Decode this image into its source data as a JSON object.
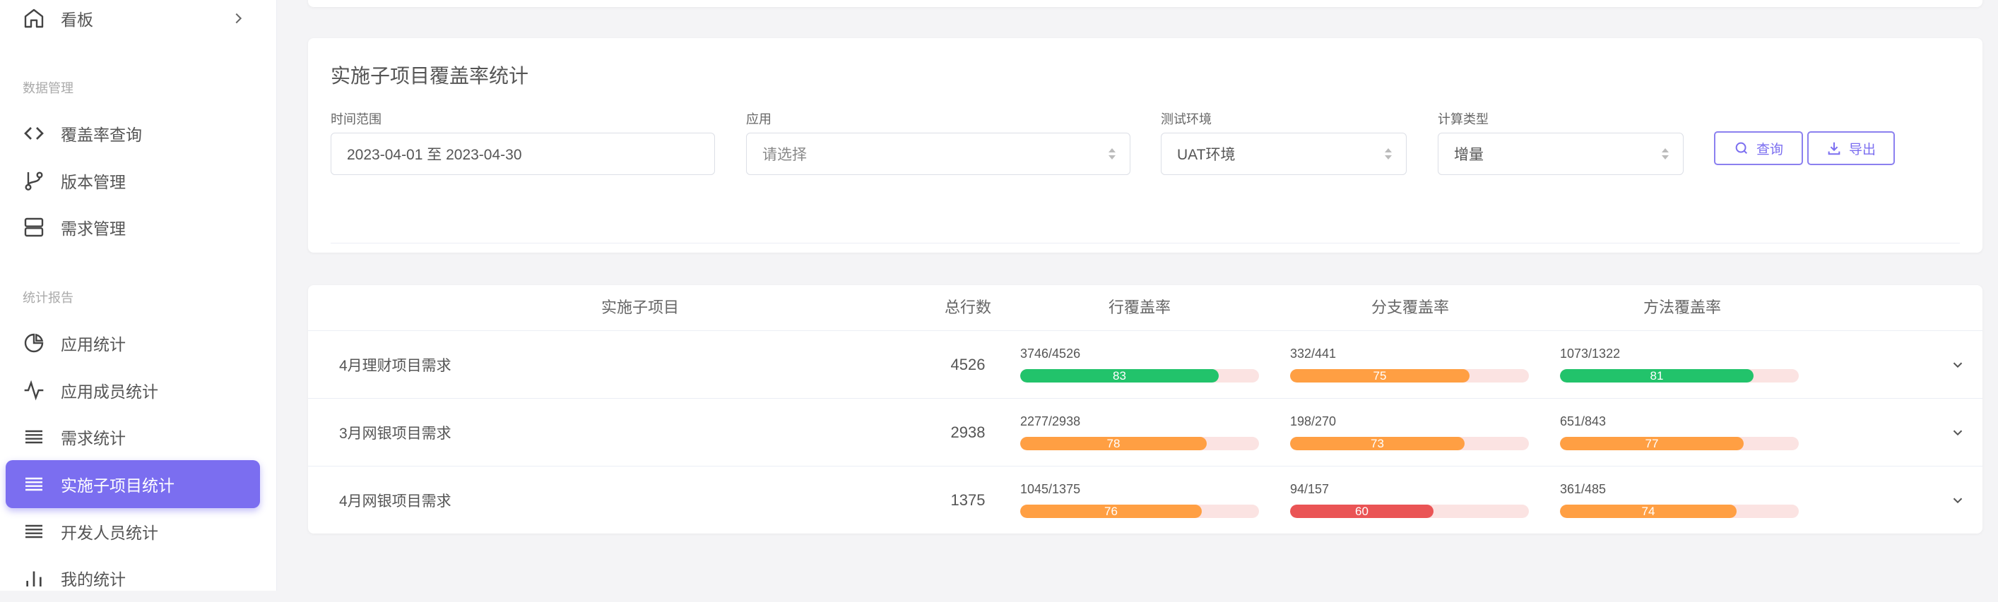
{
  "sidebar": {
    "top_item": {
      "label": "看板",
      "icon": "home-icon"
    },
    "groups": [
      {
        "title": "数据管理"
      },
      {
        "title": "统计报告"
      }
    ],
    "data_items": [
      {
        "label": "覆盖率查询",
        "icon": "code-icon"
      },
      {
        "label": "版本管理",
        "icon": "branch-icon"
      },
      {
        "label": "需求管理",
        "icon": "server-icon"
      }
    ],
    "report_items": [
      {
        "label": "应用统计",
        "icon": "pie-chart-icon"
      },
      {
        "label": "应用成员统计",
        "icon": "pulse-icon"
      },
      {
        "label": "需求统计",
        "icon": "list-icon"
      },
      {
        "label": "实施子项目统计",
        "icon": "list-icon",
        "active": true
      },
      {
        "label": "开发人员统计",
        "icon": "list-icon"
      },
      {
        "label": "我的统计",
        "icon": "bar-chart-icon"
      }
    ]
  },
  "colors": {
    "accent": "#7b6ef0",
    "green": "#22c36b",
    "orange": "#ff9f43",
    "red": "#ea5455",
    "track": "#fbe3e2"
  },
  "filter": {
    "title": "实施子项目覆盖率统计",
    "time_range": {
      "label": "时间范围",
      "value": "2023-04-01 至 2023-04-30"
    },
    "app": {
      "label": "应用",
      "placeholder": "请选择"
    },
    "env": {
      "label": "测试环境",
      "value": "UAT环境"
    },
    "calc": {
      "label": "计算类型",
      "value": "增量"
    },
    "query_button": "查询",
    "export_button": "导出"
  },
  "table": {
    "headers": {
      "project": "实施子项目",
      "total": "总行数",
      "line": "行覆盖率",
      "branch": "分支覆盖率",
      "method": "方法覆盖率"
    },
    "rows": [
      {
        "name": "4月理财项目需求",
        "total": "4526",
        "line": {
          "ratio": "3746/4526",
          "pct": 83,
          "color": "#22c36b"
        },
        "branch": {
          "ratio": "332/441",
          "pct": 75,
          "color": "#ff9f43"
        },
        "method": {
          "ratio": "1073/1322",
          "pct": 81,
          "color": "#22c36b"
        }
      },
      {
        "name": "3月网银项目需求",
        "total": "2938",
        "line": {
          "ratio": "2277/2938",
          "pct": 78,
          "color": "#ff9f43"
        },
        "branch": {
          "ratio": "198/270",
          "pct": 73,
          "color": "#ff9f43"
        },
        "method": {
          "ratio": "651/843",
          "pct": 77,
          "color": "#ff9f43"
        }
      },
      {
        "name": "4月网银项目需求",
        "total": "1375",
        "line": {
          "ratio": "1045/1375",
          "pct": 76,
          "color": "#ff9f43"
        },
        "branch": {
          "ratio": "94/157",
          "pct": 60,
          "color": "#ea5455"
        },
        "method": {
          "ratio": "361/485",
          "pct": 74,
          "color": "#ff9f43"
        }
      }
    ]
  }
}
